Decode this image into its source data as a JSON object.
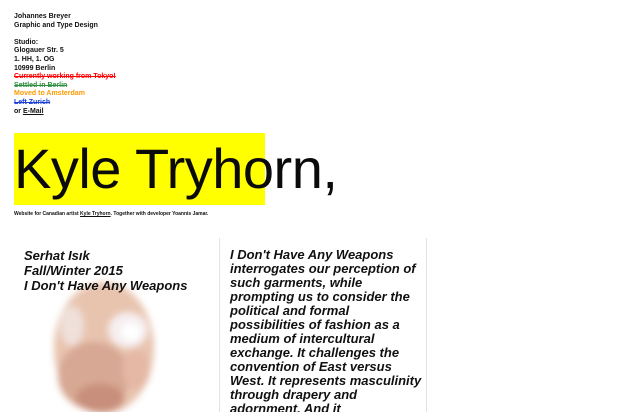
{
  "studio": {
    "name": "Johannes Breyer",
    "role": "Graphic and Type Design",
    "label": "Studio:",
    "street": "Glogauer Str. 5",
    "floor": "1. HH, 1. OG",
    "city": "10999 Berlin",
    "history": [
      {
        "text": "Currently working from Tokyo!",
        "color": "#ff0000"
      },
      {
        "text": "Settled in Berlin",
        "color": "#2f8f3f"
      },
      {
        "text": "Moved to Amsterdam",
        "color": "#ff9900"
      },
      {
        "text": "Left Zurich",
        "color": "#1c3fd6"
      }
    ],
    "contact_prefix": "or",
    "email_label": "E-Mail"
  },
  "colors": {
    "highlight": "#ffff00"
  },
  "headline": "Kyle Tryhorn,",
  "caption": {
    "before": "Website for Canadian artist",
    "link": "Kyle Tryhorn",
    "after": ". Together with developer Yoannis Jamar."
  },
  "project_card": {
    "lines": [
      "Serhat Isık",
      "Fall/Winter 2015",
      "I Don't Have Any Weapons"
    ]
  },
  "article": {
    "text": "I Don't Have Any Weapons interrogates our perception of such garments, while prompting us to consider the political and formal possibilities of fashion as a medium of intercultural exchange. It challenges the convention of East versus West. It represents masculinity through drapery and adornment. And it"
  }
}
